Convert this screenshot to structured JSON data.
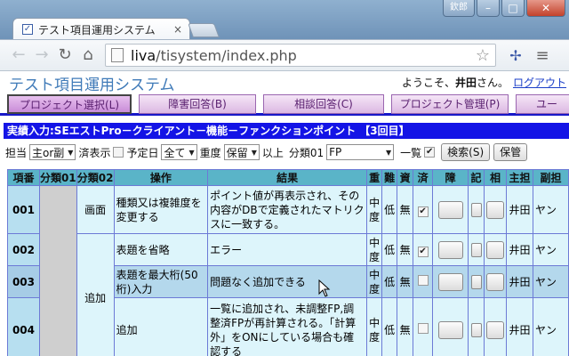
{
  "browser": {
    "tab_title": "テスト項目運用システム",
    "tab_close": "×",
    "user_badge": "欽郎",
    "url_host": "liva",
    "url_path": "/tisystem/index.php",
    "window_min": "–",
    "window_max": "□",
    "window_close": "✕"
  },
  "app": {
    "title": "テスト項目運用システム",
    "welcome_prefix": "ようこそ、",
    "user_name": "井田",
    "welcome_suffix": "さん。",
    "logout": "ログアウト"
  },
  "nav_tabs": [
    {
      "label": "プロジェクト選択(L)"
    },
    {
      "label": "障害回答(B)"
    },
    {
      "label": "相談回答(C)"
    },
    {
      "label": "プロジェクト管理(P)"
    },
    {
      "label": "ユー"
    }
  ],
  "section_title": "実績入力:SEエストPro－クライアント－機能－ファンクションポイント 【3回目】",
  "filter": {
    "owner_label": "担当",
    "owner_value": "主or副",
    "done_label": "済表示",
    "planned_label": "予定日",
    "planned_value": "全て",
    "severity_label": "重度",
    "severity_value": "保留",
    "above_label": "以上",
    "category_label": "分類01",
    "category_value": "FP",
    "list_label": "一覧",
    "search_button": "検索(S)",
    "save_button": "保管"
  },
  "table": {
    "headers": [
      "項番",
      "分類01",
      "分類02",
      "操作",
      "結果",
      "重",
      "難",
      "資",
      "済",
      "障",
      "記",
      "相",
      "主担",
      "副担"
    ],
    "rows": [
      {
        "id": "001",
        "cat02": "画面",
        "op": "種類又は複雑度を変更する",
        "result": "ポイント値が再表示され、その内容がDBで定義されたマトリクスに一致する。",
        "sev": "中度",
        "diff": "低",
        "res": "無",
        "done": true,
        "main": "井田",
        "sub": "ヤン"
      },
      {
        "id": "002",
        "cat02": "",
        "op": "表題を省略",
        "result": "エラー",
        "sev": "中度",
        "diff": "低",
        "res": "無",
        "done": true,
        "main": "井田",
        "sub": "ヤン"
      },
      {
        "id": "003",
        "cat02": "",
        "op": "表題を最大桁(50桁)入力",
        "result": "問題なく追加できる",
        "sev": "中度",
        "diff": "低",
        "res": "無",
        "done": false,
        "main": "井田",
        "sub": "ヤン"
      },
      {
        "id": "004",
        "cat02": "追加",
        "op": "追加",
        "result": "一覧に追加され、未調整FP,調整済FPが再計算される。「計算外」をONにしている場合も確認する",
        "sev": "中度",
        "diff": "低",
        "res": "無",
        "done": false,
        "main": "井田",
        "sub": "ヤン"
      }
    ]
  }
}
